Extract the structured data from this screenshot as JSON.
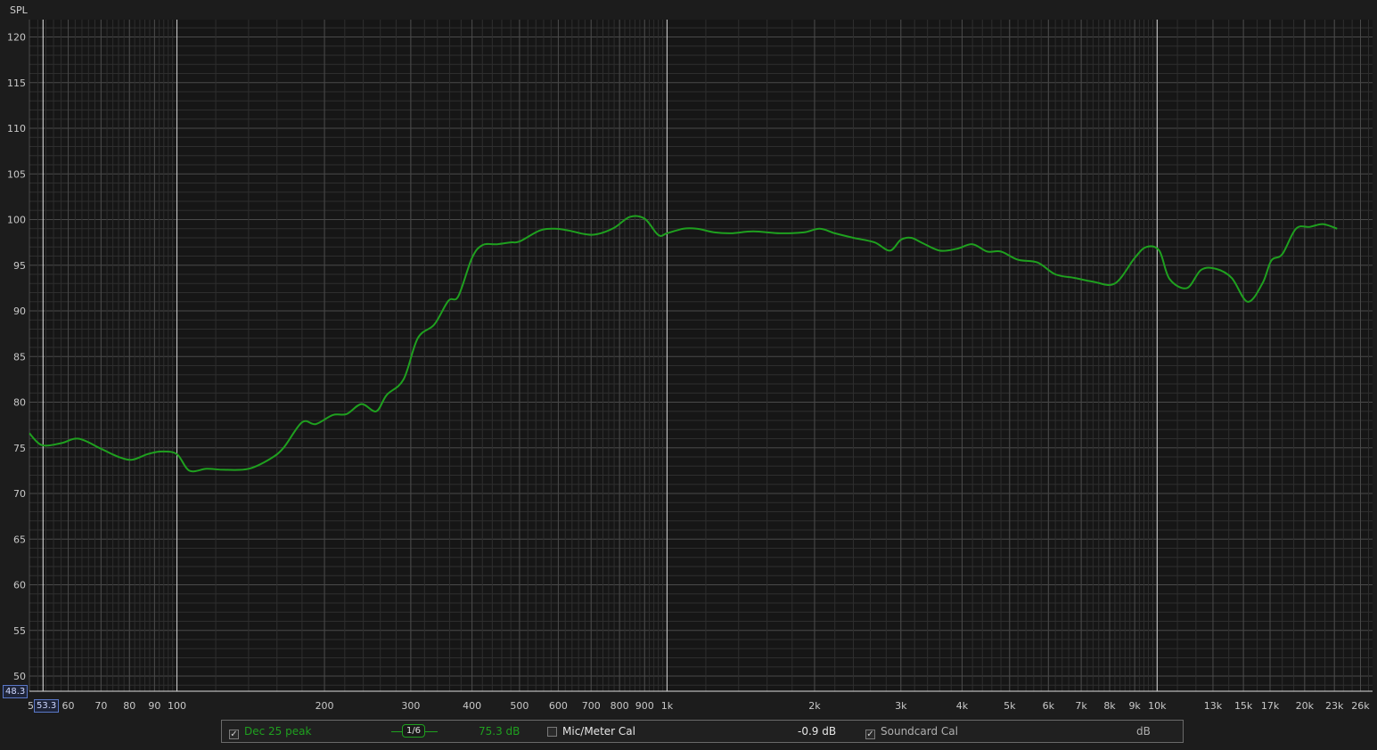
{
  "app": {
    "axis_title": "SPL"
  },
  "cursor": {
    "y_readout": "48.3",
    "x_readout": "53.3"
  },
  "colors": {
    "trace": "#1fa01f",
    "background": "#1c1c1c",
    "grid_major": "#4a4a4a",
    "grid_minor": "#2e2e2e",
    "grid_decade": "#cfcfcf"
  },
  "legend": {
    "trace_checked": true,
    "trace_name": "Dec 25 peak",
    "smoothing": "1/6",
    "trace_value": "75.3 dB",
    "mic_cal_checked": false,
    "mic_cal_label": "Mic/Meter Cal",
    "mic_cal_value": "-0.9 dB",
    "soundcard_checked": true,
    "soundcard_label": "Soundcard Cal",
    "soundcard_value": "dB"
  },
  "chart_data": {
    "type": "line",
    "title": "",
    "xlabel": "",
    "ylabel": "SPL",
    "xscale": "log",
    "xlim": [
      50,
      27000
    ],
    "ylim": [
      48.3,
      122.5
    ],
    "grid": true,
    "y_ticks": [
      50,
      55,
      60,
      65,
      70,
      75,
      80,
      85,
      90,
      95,
      100,
      105,
      110,
      115,
      120
    ],
    "x_ticks": [
      {
        "v": 50,
        "label": "5"
      },
      {
        "v": 60,
        "label": "60"
      },
      {
        "v": 70,
        "label": "70"
      },
      {
        "v": 80,
        "label": "80"
      },
      {
        "v": 90,
        "label": "90"
      },
      {
        "v": 100,
        "label": "100"
      },
      {
        "v": 200,
        "label": "200"
      },
      {
        "v": 300,
        "label": "300"
      },
      {
        "v": 400,
        "label": "400"
      },
      {
        "v": 500,
        "label": "500"
      },
      {
        "v": 600,
        "label": "600"
      },
      {
        "v": 700,
        "label": "700"
      },
      {
        "v": 800,
        "label": "800"
      },
      {
        "v": 900,
        "label": "900"
      },
      {
        "v": 1000,
        "label": "1k"
      },
      {
        "v": 2000,
        "label": "2k"
      },
      {
        "v": 3000,
        "label": "3k"
      },
      {
        "v": 4000,
        "label": "4k"
      },
      {
        "v": 5000,
        "label": "5k"
      },
      {
        "v": 6000,
        "label": "6k"
      },
      {
        "v": 7000,
        "label": "7k"
      },
      {
        "v": 8000,
        "label": "8k"
      },
      {
        "v": 9000,
        "label": "9k"
      },
      {
        "v": 10000,
        "label": "10k"
      },
      {
        "v": 13000,
        "label": "13k"
      },
      {
        "v": 15000,
        "label": "15k"
      },
      {
        "v": 17000,
        "label": "17k"
      },
      {
        "v": 20000,
        "label": "20k"
      },
      {
        "v": 23000,
        "label": "23k"
      },
      {
        "v": 26000,
        "label": "26k"
      }
    ],
    "series": [
      {
        "name": "Dec 25 peak",
        "color": "#1fa01f",
        "x": [
          50,
          53,
          58,
          63,
          70,
          76,
          81,
          87,
          93,
          100,
          106,
          115,
          125,
          140,
          155,
          165,
          180,
          192,
          208,
          222,
          238,
          255,
          268,
          290,
          310,
          335,
          358,
          375,
          400,
          420,
          450,
          480,
          500,
          550,
          590,
          630,
          680,
          720,
          780,
          840,
          900,
          960,
          1000,
          1080,
          1150,
          1250,
          1350,
          1500,
          1700,
          1900,
          2050,
          2200,
          2400,
          2650,
          2850,
          3000,
          3150,
          3300,
          3600,
          3900,
          4200,
          4500,
          4800,
          5200,
          5700,
          6200,
          6800,
          7400,
          8200,
          9000,
          9500,
          10100,
          10600,
          11500,
          12300,
          13200,
          14200,
          15300,
          16400,
          17100,
          18000,
          19200,
          20500,
          21800,
          23300
        ],
        "y": [
          76.6,
          75.3,
          75.5,
          76.0,
          74.9,
          74.0,
          73.7,
          74.3,
          74.6,
          74.3,
          72.5,
          72.7,
          72.6,
          72.7,
          73.8,
          75.0,
          77.8,
          77.6,
          78.6,
          78.7,
          79.8,
          79.0,
          80.8,
          82.5,
          87.0,
          88.5,
          91.1,
          91.6,
          95.8,
          97.2,
          97.3,
          97.5,
          97.6,
          98.8,
          99.0,
          98.8,
          98.4,
          98.4,
          99.1,
          100.3,
          100.1,
          98.3,
          98.5,
          99.0,
          99.0,
          98.6,
          98.5,
          98.7,
          98.5,
          98.6,
          99.0,
          98.5,
          98.0,
          97.5,
          96.6,
          97.8,
          98.0,
          97.5,
          96.6,
          96.8,
          97.3,
          96.5,
          96.5,
          95.6,
          95.3,
          94.0,
          93.6,
          93.2,
          93.0,
          95.8,
          97.0,
          96.6,
          93.5,
          92.5,
          94.5,
          94.6,
          93.6,
          91.0,
          93.0,
          95.5,
          96.2,
          99.0,
          99.2,
          99.5,
          99.0
        ]
      }
    ]
  }
}
